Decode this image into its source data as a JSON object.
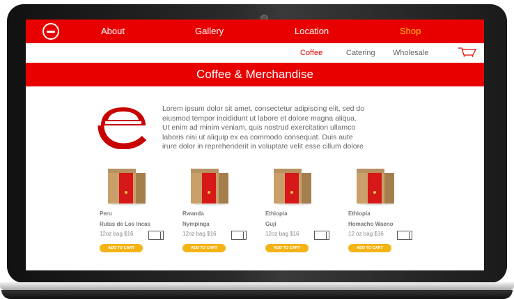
{
  "nav": {
    "items": [
      "About",
      "Gallery",
      "Location"
    ],
    "shop_label": "Shop"
  },
  "subnav": {
    "items": [
      "Coffee",
      "Catering",
      "Wholesale"
    ],
    "active": "Coffee"
  },
  "banner": {
    "title": "Coffee & Merchandise"
  },
  "intro": {
    "lines": [
      "Lorem ipsum dolor sit amet, consectetur adipiscing elit, sed do",
      "eiusmod tempor incididunt ut labore et dolore magna aliqua.",
      "Ut enim ad minim veniam, quis nostrud exercitation ullamco",
      "laboris nisi ut aliquip ex ea commodo consequat. Duis aute",
      "irure dolor in reprehenderit in voluptate velit esse cillum dolore"
    ]
  },
  "products": [
    {
      "origin": "Peru",
      "name": "Rutas de Los Incas",
      "price": "12oz bag  $16",
      "button": "ADD TO CART"
    },
    {
      "origin": "Rwanda",
      "name": "Nympinga",
      "price": "12oz bag  $16",
      "button": "ADD TO CART"
    },
    {
      "origin": "Ethiopia",
      "name": "Guji",
      "price": "12oz bag  $16",
      "button": "ADD TO CART"
    },
    {
      "origin": "Ethiopia",
      "name": "Homacho Waeno",
      "price": "12 oz bag  $16",
      "button": "ADD TO CART"
    }
  ],
  "colors": {
    "brand_red": "#e80000",
    "accent_yellow": "#f6c21a",
    "button_yellow": "#f4b416"
  },
  "icons": {
    "logo": "e-circle-logo-icon",
    "cart": "shopping-cart-icon",
    "bag": "coffee-bag-icon"
  }
}
